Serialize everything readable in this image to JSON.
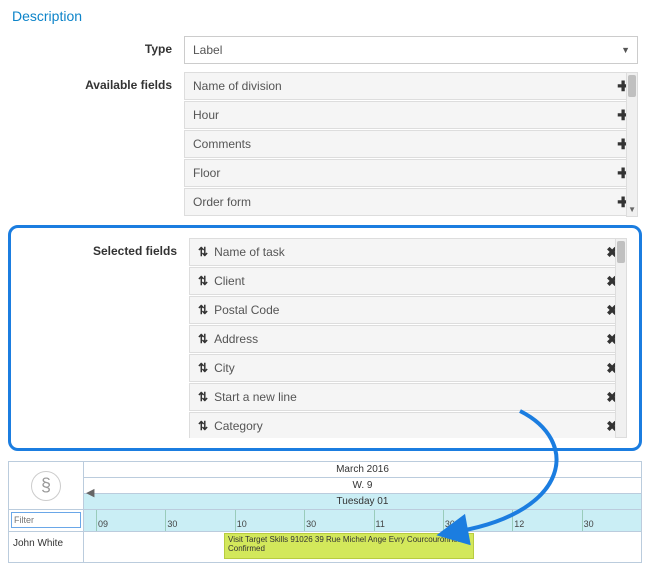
{
  "section_title": "Description",
  "labels": {
    "type": "Type",
    "available": "Available fields",
    "selected": "Selected fields"
  },
  "type_select": {
    "value": "Label"
  },
  "available_fields": [
    {
      "label": "Name of division"
    },
    {
      "label": "Hour"
    },
    {
      "label": "Comments"
    },
    {
      "label": "Floor"
    },
    {
      "label": "Order form"
    }
  ],
  "selected_fields": [
    {
      "label": "Name of task"
    },
    {
      "label": "Client"
    },
    {
      "label": "Postal Code"
    },
    {
      "label": "Address"
    },
    {
      "label": "City"
    },
    {
      "label": "Start a new line"
    },
    {
      "label": "Category"
    }
  ],
  "timeline": {
    "filter_placeholder": "Filter",
    "resource": "John White",
    "month": "March 2016",
    "week": "W. 9",
    "day": "Tuesday 01",
    "hours": [
      "09",
      "30",
      "10",
      "30",
      "11",
      "30",
      "12",
      "30"
    ],
    "task_line1": "Visit Target Skills 91026 39 Rue Michel Ange Evry Courcouronnes",
    "task_line2": "Confirmed"
  },
  "icons": {
    "plus": "✚",
    "remove": "✖",
    "sort": "⇅",
    "caret": "▼",
    "nav_left": "◀"
  }
}
